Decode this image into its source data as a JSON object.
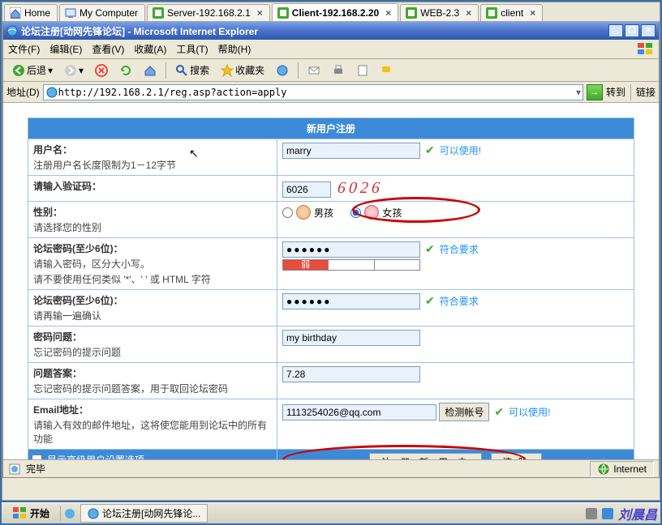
{
  "vm_tabs": [
    {
      "label": "Home",
      "active": false,
      "closable": false
    },
    {
      "label": "My Computer",
      "active": false,
      "closable": false
    },
    {
      "label": "Server-192.168.2.1",
      "active": false,
      "closable": true
    },
    {
      "label": "Client-192.168.2.20",
      "active": true,
      "closable": true
    },
    {
      "label": "WEB-2.3",
      "active": false,
      "closable": true
    },
    {
      "label": "client",
      "active": false,
      "closable": true
    }
  ],
  "ie": {
    "title": "论坛注册[动网先锋论坛] - Microsoft Internet Explorer",
    "menu": [
      "文件(F)",
      "编辑(E)",
      "查看(V)",
      "收藏(A)",
      "工具(T)",
      "帮助(H)"
    ],
    "back": "后退",
    "search": "搜索",
    "fav": "收藏夹",
    "addr_label": "地址(D)",
    "url": "http://192.168.2.1/reg.asp?action=apply",
    "go": "转到",
    "links": "链接",
    "status_left": "完毕",
    "status_right": "Internet"
  },
  "form": {
    "header": "新用户注册",
    "username": {
      "label": "用户名：",
      "desc": "注册用户名长度限制为1－12字节",
      "value": "marry",
      "hint": "可以使用!"
    },
    "captcha": {
      "label": "请输入验证码：",
      "value": "6026",
      "image": "6026"
    },
    "gender": {
      "label": "性别：",
      "desc": "请选择您的性别",
      "boy": "男孩",
      "girl": "女孩",
      "selected": "girl"
    },
    "pwd1": {
      "label": "论坛密码(至少6位)：",
      "desc1": "请输入密码，区分大小写。",
      "desc2": "请不要使用任何类似 '*'、' ' 或 HTML 字符",
      "value": "●●●●●●",
      "hint": "符合要求",
      "strength": "弱"
    },
    "pwd2": {
      "label": "论坛密码(至少6位)：",
      "desc": "请再输一遍确认",
      "value": "●●●●●●",
      "hint": "符合要求"
    },
    "question": {
      "label": "密码问题：",
      "desc": "忘记密码的提示问题",
      "value": "my birthday"
    },
    "answer": {
      "label": "问题答案：",
      "desc": "忘记密码的提示问题答案，用于取回论坛密码",
      "value": "7.28"
    },
    "email": {
      "label": "Email地址：",
      "desc": "请输入有效的邮件地址，这将使您能用到论坛中的所有功能",
      "value": "1113254026@qq.com",
      "checkbtn": "检测帐号",
      "hint": "可以使用!"
    },
    "adv": "显示高级用户设置选项",
    "submit": "注 册 新 用 户",
    "clear": "清 除"
  },
  "taskbar": {
    "start": "开始",
    "task": "论坛注册[动网先锋论...",
    "watermark": "刘晨昌"
  }
}
